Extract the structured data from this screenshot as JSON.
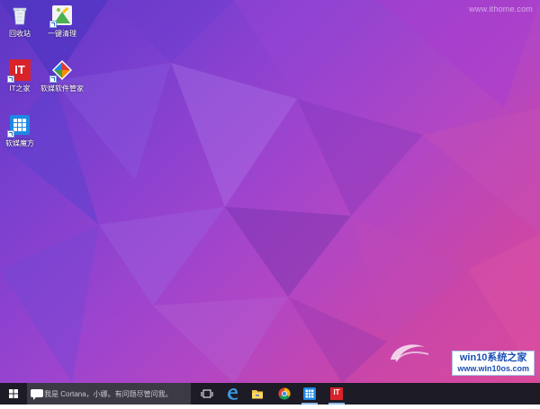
{
  "watermark_top": "www.ithome.com",
  "desktop_icons": [
    {
      "label": "回收站",
      "icon": "recycle-bin-icon"
    },
    {
      "label": "一键清理",
      "icon": "cleanup-icon"
    },
    {
      "label": "IT之家",
      "icon": "ithome-app-icon",
      "icon_text": "IT"
    },
    {
      "label": "软媒软件管家",
      "icon": "software-manager-icon"
    },
    {
      "label": "软媒魔方",
      "icon": "rubik-cube-icon"
    }
  ],
  "stamp": {
    "title": "win10系统之家",
    "url": "www.win10os.com"
  },
  "taskbar": {
    "search_placeholder": "我是 Cortana，小娜。有问题尽管问我。",
    "pinned": [
      {
        "icon": "task-view-icon"
      },
      {
        "icon": "edge-icon"
      },
      {
        "icon": "file-explorer-icon"
      },
      {
        "icon": "chrome-icon"
      },
      {
        "icon": "rubik-cube-icon"
      },
      {
        "icon": "ithome-app-icon",
        "icon_text": "IT"
      }
    ]
  },
  "colors": {
    "taskbar": "#1d1b26",
    "search_box": "#3c3a44",
    "ithome_red": "#d8232a",
    "stamp_blue": "#1a4fb3"
  }
}
